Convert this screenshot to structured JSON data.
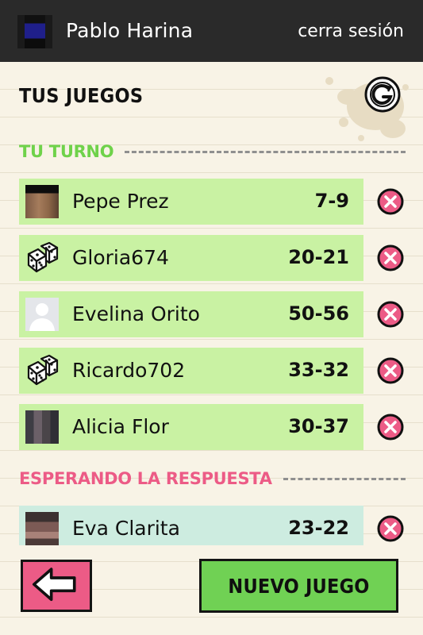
{
  "header": {
    "user_name": "Pablo Harina",
    "logout_label": "cerra sesión"
  },
  "page": {
    "title": "TUS JUEGOS"
  },
  "sections": {
    "your_turn_label": "TU TURNO",
    "waiting_label": "ESPERANDO LA RESPUESTA"
  },
  "games_your_turn": [
    {
      "player": "Pepe Prez",
      "score": "7-9",
      "avatar": "pixelated-photo"
    },
    {
      "player": "Gloria674",
      "score": "20-21",
      "avatar": "dice-icon"
    },
    {
      "player": "Evelina Orito",
      "score": "50-56",
      "avatar": "default-person-icon"
    },
    {
      "player": "Ricardo702",
      "score": "33-32",
      "avatar": "dice-icon"
    },
    {
      "player": "Alicia Flor",
      "score": "30-37",
      "avatar": "pixelated-photo"
    }
  ],
  "games_waiting": [
    {
      "player": "Eva Clarita",
      "score": "23-22",
      "avatar": "pixelated-photo"
    }
  ],
  "footer": {
    "new_game_label": "NUEVO JUEGO"
  },
  "colors": {
    "header_bg": "#2a2a2a",
    "turn_green": "#6fd24a",
    "row_green": "#c9f2a3",
    "waiting_pink": "#ec5b86",
    "row_mint": "#cdece0",
    "delete_pink": "#ec5b86"
  }
}
